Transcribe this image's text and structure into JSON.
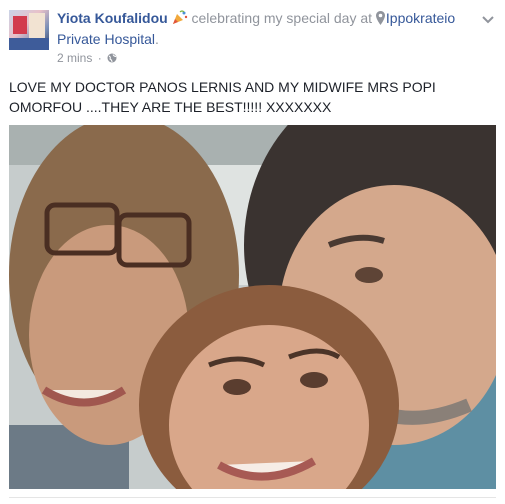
{
  "post": {
    "author": "Yiota Koufalidou",
    "activity_emoji_icon": "party-popper-icon",
    "activity_text": "celebrating my special day at",
    "location_icon": "map-pin-icon",
    "location_line1": "Ippokrateio",
    "location_line2": "Private Hospital",
    "location_suffix": ".",
    "timestamp": "2 mins",
    "separator": "·",
    "audience_icon": "globe-icon",
    "menu_icon": "chevron-down-icon",
    "body": "LOVE MY DOCTOR PANOS LERNIS AND MY MIDWIFE MRS POPI OMORFOU ....THEY ARE THE BEST!!!!! XXXXXXX"
  },
  "colors": {
    "link": "#365899",
    "secondary": "#90949c",
    "text": "#1d2129"
  }
}
